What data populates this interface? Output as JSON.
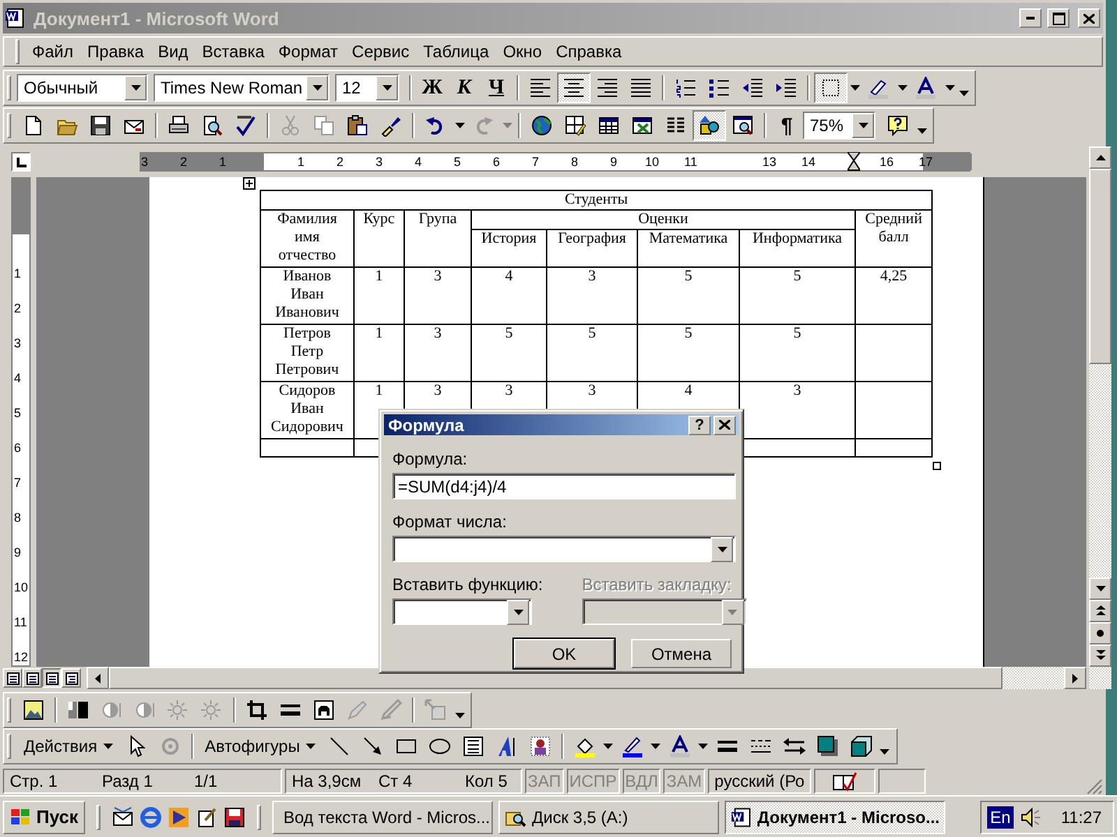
{
  "window": {
    "title": "Документ1 - Microsoft Word"
  },
  "menu": [
    "Файл",
    "Правка",
    "Вид",
    "Вставка",
    "Формат",
    "Сервис",
    "Таблица",
    "Окно",
    "Справка"
  ],
  "formatting_toolbar": [
    {
      "kind": "style-combo",
      "value": "Обычный"
    },
    {
      "kind": "font-combo",
      "value": "Times New Roman"
    },
    {
      "kind": "size-combo",
      "value": "12"
    },
    {
      "kind": "separator"
    },
    {
      "kind": "bold",
      "label": "Ж",
      "pressed": false
    },
    {
      "kind": "italic",
      "label": "К",
      "pressed": false
    },
    {
      "kind": "underline",
      "label": "Ч",
      "pressed": false
    },
    {
      "kind": "separator"
    },
    {
      "kind": "align-left",
      "pressed": false
    },
    {
      "kind": "align-center",
      "pressed": true
    },
    {
      "kind": "align-right",
      "pressed": false
    },
    {
      "kind": "justify",
      "pressed": false
    },
    {
      "kind": "separator"
    },
    {
      "kind": "numbering",
      "pressed": false
    },
    {
      "kind": "bullets",
      "pressed": false
    },
    {
      "kind": "outdent"
    },
    {
      "kind": "indent"
    },
    {
      "kind": "separator"
    },
    {
      "kind": "border",
      "pressed": true
    },
    {
      "kind": "dropdown"
    },
    {
      "kind": "highlight"
    },
    {
      "kind": "dropdown"
    },
    {
      "kind": "font-color"
    },
    {
      "kind": "dropdown"
    },
    {
      "kind": "more"
    }
  ],
  "standard_toolbar": [
    {
      "kind": "new"
    },
    {
      "kind": "open"
    },
    {
      "kind": "save"
    },
    {
      "kind": "email"
    },
    {
      "kind": "separator"
    },
    {
      "kind": "print"
    },
    {
      "kind": "preview"
    },
    {
      "kind": "spell"
    },
    {
      "kind": "separator"
    },
    {
      "kind": "cut",
      "disabled": true
    },
    {
      "kind": "copy",
      "disabled": true
    },
    {
      "kind": "paste"
    },
    {
      "kind": "painter"
    },
    {
      "kind": "separator"
    },
    {
      "kind": "undo"
    },
    {
      "kind": "dropdown"
    },
    {
      "kind": "redo",
      "disabled": true
    },
    {
      "kind": "dropdown",
      "disabled": true
    },
    {
      "kind": "separator"
    },
    {
      "kind": "hyperlink"
    },
    {
      "kind": "tables-borders"
    },
    {
      "kind": "insert-table"
    },
    {
      "kind": "excel"
    },
    {
      "kind": "columns"
    },
    {
      "kind": "drawing",
      "pressed": true
    },
    {
      "kind": "docmap",
      "pressed": false
    },
    {
      "kind": "separator"
    },
    {
      "kind": "pilcrow",
      "label": "¶",
      "pressed": false
    },
    {
      "kind": "zoom-combo",
      "value": "75%"
    },
    {
      "kind": "help"
    },
    {
      "kind": "more"
    }
  ],
  "ruler": {
    "horizontal": [
      "3",
      "2",
      "1",
      "1",
      "2",
      "3",
      "4",
      "5",
      "6",
      "7",
      "8",
      "9",
      "10",
      "11",
      "13",
      "14",
      "16",
      "17"
    ],
    "vertical": [
      "1",
      "2",
      "3",
      "4",
      "5",
      "6",
      "7",
      "8",
      "9",
      "10",
      "11",
      "12"
    ]
  },
  "table": {
    "title": "Студенты",
    "header_rows": [
      [
        {
          "label": "Фамилия\nимя\nотчество",
          "rowspan": 2
        },
        {
          "label": "Курс",
          "rowspan": 2
        },
        {
          "label": "Група",
          "rowspan": 2
        },
        {
          "label": "Оценки",
          "colspan": 4
        },
        {
          "label": "Средний\nбалл",
          "rowspan": 2
        }
      ],
      [
        {
          "label": "История"
        },
        {
          "label": "География"
        },
        {
          "label": "Математика"
        },
        {
          "label": "Информатика"
        }
      ]
    ],
    "rows": [
      {
        "cells": [
          "Иванов\nИван\nИванович",
          "1",
          "3",
          "4",
          "3",
          "5",
          "5",
          "4,25"
        ]
      },
      {
        "cells": [
          "Петров\nПетр\nПетрович",
          "1",
          "3",
          "5",
          "5",
          "5",
          "5"
        ]
      },
      {
        "cells": [
          "Сидоров\nИван\nСидорович",
          "1",
          "3",
          "3",
          "3",
          "4",
          "3"
        ]
      }
    ]
  },
  "dialog": {
    "title": "Формула",
    "help": "?",
    "formula": {
      "label": "Формула:",
      "value": "=SUM(d4:j4)/4"
    },
    "number_format": {
      "label": "Формат числа:"
    },
    "insert_function": {
      "label": "Вставить функцию:",
      "disabled": false
    },
    "insert_bookmark": {
      "label": "Вставить закладку:",
      "disabled": true
    },
    "buttons": [
      {
        "label": "OK",
        "default": true
      },
      {
        "label": "Отмена",
        "default": false
      }
    ]
  },
  "picture_toolbar": [
    {
      "kind": "insert-picture"
    },
    {
      "kind": "separator"
    },
    {
      "kind": "image-color"
    },
    {
      "kind": "more-contrast",
      "disabled": true
    },
    {
      "kind": "less-contrast",
      "disabled": true
    },
    {
      "kind": "more-brightness",
      "disabled": true
    },
    {
      "kind": "less-brightness",
      "disabled": true
    },
    {
      "kind": "separator"
    },
    {
      "kind": "crop"
    },
    {
      "kind": "line-weight"
    },
    {
      "kind": "text-wrap"
    },
    {
      "kind": "format-picture",
      "disabled": true
    },
    {
      "kind": "set-transparent",
      "disabled": true
    },
    {
      "kind": "separator"
    },
    {
      "kind": "reset-picture",
      "disabled": true
    },
    {
      "kind": "more"
    }
  ],
  "drawing_toolbar": [
    {
      "kind": "menu",
      "label": "Действия"
    },
    {
      "kind": "pointer"
    },
    {
      "kind": "rotate",
      "disabled": true
    },
    {
      "kind": "separator"
    },
    {
      "kind": "menu",
      "label": "Автофигуры"
    },
    {
      "kind": "line"
    },
    {
      "kind": "arrow"
    },
    {
      "kind": "rectangle"
    },
    {
      "kind": "oval"
    },
    {
      "kind": "textbox"
    },
    {
      "kind": "wordart"
    },
    {
      "kind": "clipart"
    },
    {
      "kind": "separator"
    },
    {
      "kind": "fill-color"
    },
    {
      "kind": "dropdown"
    },
    {
      "kind": "line-color"
    },
    {
      "kind": "dropdown"
    },
    {
      "kind": "font-color"
    },
    {
      "kind": "dropdown"
    },
    {
      "kind": "line-style"
    },
    {
      "kind": "dash-style"
    },
    {
      "kind": "arrow-style"
    },
    {
      "kind": "shadow"
    },
    {
      "kind": "depth"
    },
    {
      "kind": "more"
    }
  ],
  "status_bar": {
    "position": [
      "Стр. 1",
      "Разд 1",
      "1/1"
    ],
    "cursor": [
      "На 3,9см",
      "Ст 4",
      "Кол 5"
    ],
    "modes": [
      {
        "label": "ЗАП",
        "active": false
      },
      {
        "label": "ИСПР",
        "active": false
      },
      {
        "label": "ВДЛ",
        "active": false
      },
      {
        "label": "ЗАМ",
        "active": false
      }
    ],
    "language": "русский (Ро"
  },
  "taskbar": {
    "start": "Пуск",
    "tasks": [
      {
        "label": "Вод текста Word - Micros...",
        "kind": "document",
        "selected": false
      },
      {
        "label": "Диск 3,5 (A:)",
        "kind": "drive",
        "selected": false
      },
      {
        "label": "Документ1 - Microso...",
        "kind": "document",
        "selected": true
      }
    ],
    "language": "En",
    "time": "11:27"
  }
}
